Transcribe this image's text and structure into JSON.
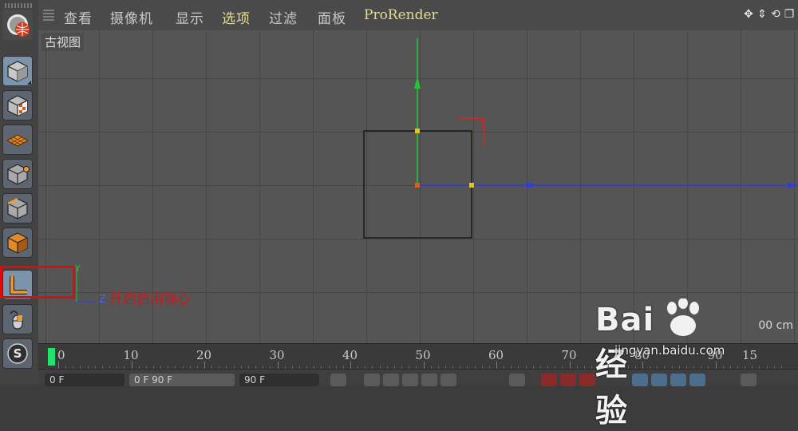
{
  "menu": {
    "items": [
      {
        "label": "查看",
        "highlight": false
      },
      {
        "label": "摄像机",
        "highlight": false
      },
      {
        "label": "显示",
        "highlight": false
      },
      {
        "label": "选项",
        "highlight": true
      },
      {
        "label": "过滤",
        "highlight": false
      },
      {
        "label": "面板",
        "highlight": false
      },
      {
        "label": "ProRender",
        "highlight": true
      }
    ],
    "nav_icons": [
      "move-view-icon",
      "zoom-view-icon",
      "rotate-view-icon",
      "maximize-view-icon"
    ]
  },
  "viewport": {
    "view_name": "古视图",
    "scale_text": "00 cm"
  },
  "toolbar": {
    "tools": [
      {
        "name": "cinema4d-logo-icon"
      },
      {
        "name": "model-mode-icon"
      },
      {
        "name": "texture-mode-icon"
      },
      {
        "name": "workplane-icon"
      },
      {
        "name": "point-mode-icon"
      },
      {
        "name": "edge-mode-icon"
      },
      {
        "name": "polygon-mode-icon"
      },
      {
        "name": "enable-axis-icon"
      },
      {
        "name": "tweak-mode-icon"
      },
      {
        "name": "snap-icon"
      }
    ],
    "snap_label": "S"
  },
  "annotation": {
    "text": "开启启用轴心",
    "axis_letters": {
      "y": "Y",
      "z": "Z"
    }
  },
  "timeline": {
    "ticks": [
      "0",
      "10",
      "20",
      "30",
      "40",
      "50",
      "60",
      "70",
      "80",
      "90"
    ],
    "extra": "15"
  },
  "bottom_bar": {
    "start_frame": "0 F",
    "range": "0 F    90 F",
    "end_frame": "90 F"
  },
  "watermark": {
    "brand": "Bai  经验",
    "url": "jingyan.baidu.com"
  },
  "colors": {
    "axis_y": "#22c832",
    "axis_x": "#2f3ed8",
    "accent_red": "#e10a0a",
    "menu_highlight": "#e9dc8a"
  }
}
